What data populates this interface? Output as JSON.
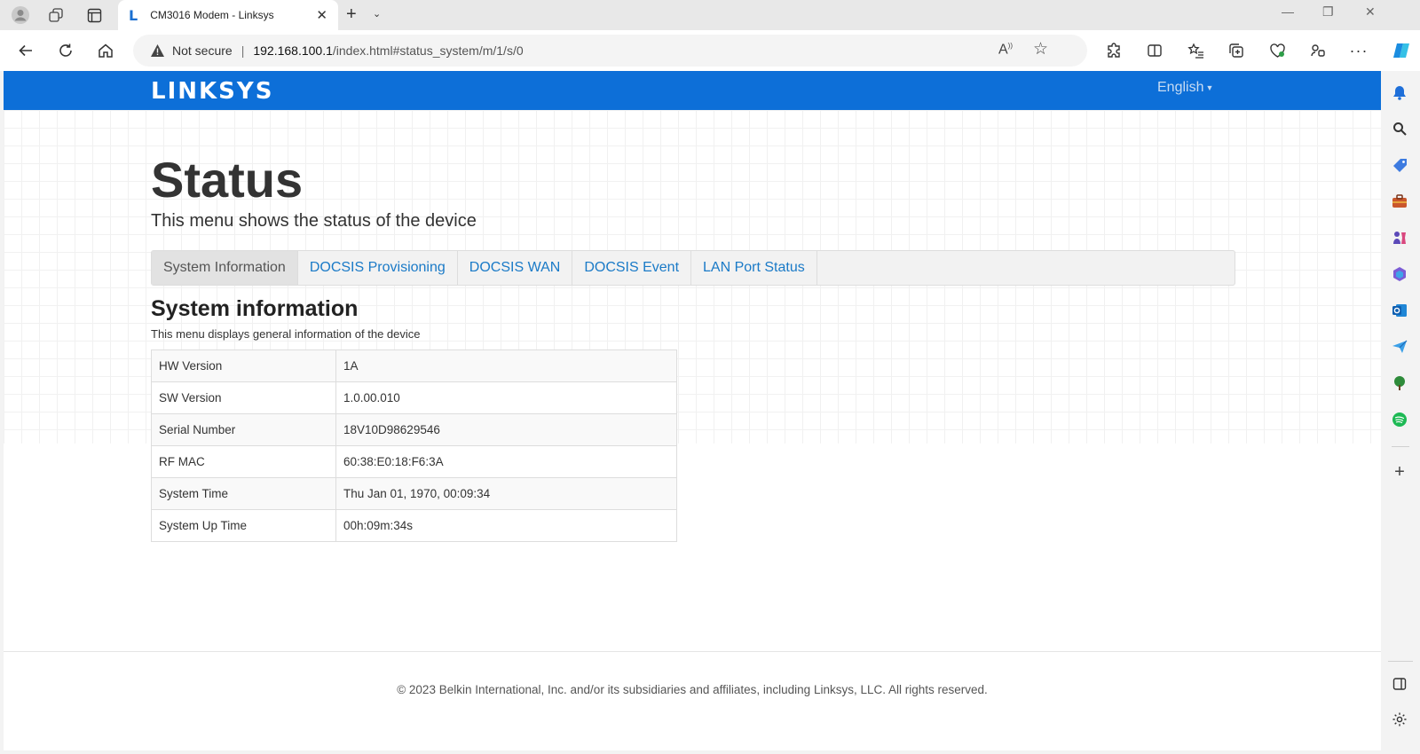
{
  "browser": {
    "tab_title": "CM3016 Modem - Linksys",
    "favicon_letter": "L",
    "address": {
      "security_label": "Not secure",
      "url_host": "192.168.100.1",
      "url_path": "/index.html#status_system/m/1/s/0"
    }
  },
  "header": {
    "logo": "LINKSYS",
    "language": "English"
  },
  "page": {
    "title": "Status",
    "subtitle": "This menu shows the status of the device"
  },
  "tabs": [
    {
      "label": "System Information",
      "active": true
    },
    {
      "label": "DOCSIS Provisioning",
      "active": false
    },
    {
      "label": "DOCSIS WAN",
      "active": false
    },
    {
      "label": "DOCSIS Event",
      "active": false
    },
    {
      "label": "LAN Port Status",
      "active": false
    }
  ],
  "section": {
    "title": "System information",
    "description": "This menu displays general information of the device"
  },
  "system_info": [
    {
      "label": "HW Version",
      "value": "1A"
    },
    {
      "label": "SW Version",
      "value": "1.0.00.010"
    },
    {
      "label": "Serial Number",
      "value": "18V10D98629546"
    },
    {
      "label": "RF MAC",
      "value": "60:38:E0:18:F6:3A"
    },
    {
      "label": "System Time",
      "value": "Thu Jan 01, 1970, 00:09:34"
    },
    {
      "label": "System Up Time",
      "value": "00h:09m:34s"
    }
  ],
  "footer": {
    "copyright": "© 2023 Belkin International, Inc. and/or its subsidiaries and affiliates, including Linksys, LLC. All rights reserved."
  },
  "colors": {
    "brand_blue": "#0d6fd8",
    "link_blue": "#1a7ac7"
  }
}
